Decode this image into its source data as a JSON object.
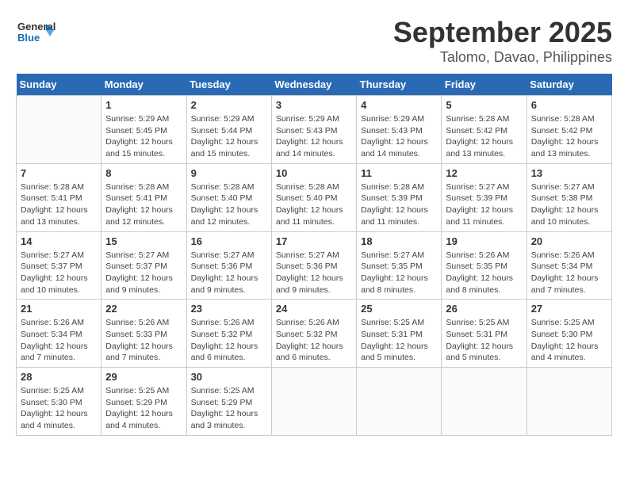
{
  "header": {
    "logo_general": "General",
    "logo_blue": "Blue",
    "month": "September 2025",
    "location": "Talomo, Davao, Philippines"
  },
  "days_of_week": [
    "Sunday",
    "Monday",
    "Tuesday",
    "Wednesday",
    "Thursday",
    "Friday",
    "Saturday"
  ],
  "weeks": [
    [
      {
        "day": "",
        "info": ""
      },
      {
        "day": "1",
        "info": "Sunrise: 5:29 AM\nSunset: 5:45 PM\nDaylight: 12 hours\nand 15 minutes."
      },
      {
        "day": "2",
        "info": "Sunrise: 5:29 AM\nSunset: 5:44 PM\nDaylight: 12 hours\nand 15 minutes."
      },
      {
        "day": "3",
        "info": "Sunrise: 5:29 AM\nSunset: 5:43 PM\nDaylight: 12 hours\nand 14 minutes."
      },
      {
        "day": "4",
        "info": "Sunrise: 5:29 AM\nSunset: 5:43 PM\nDaylight: 12 hours\nand 14 minutes."
      },
      {
        "day": "5",
        "info": "Sunrise: 5:28 AM\nSunset: 5:42 PM\nDaylight: 12 hours\nand 13 minutes."
      },
      {
        "day": "6",
        "info": "Sunrise: 5:28 AM\nSunset: 5:42 PM\nDaylight: 12 hours\nand 13 minutes."
      }
    ],
    [
      {
        "day": "7",
        "info": "Sunrise: 5:28 AM\nSunset: 5:41 PM\nDaylight: 12 hours\nand 13 minutes."
      },
      {
        "day": "8",
        "info": "Sunrise: 5:28 AM\nSunset: 5:41 PM\nDaylight: 12 hours\nand 12 minutes."
      },
      {
        "day": "9",
        "info": "Sunrise: 5:28 AM\nSunset: 5:40 PM\nDaylight: 12 hours\nand 12 minutes."
      },
      {
        "day": "10",
        "info": "Sunrise: 5:28 AM\nSunset: 5:40 PM\nDaylight: 12 hours\nand 11 minutes."
      },
      {
        "day": "11",
        "info": "Sunrise: 5:28 AM\nSunset: 5:39 PM\nDaylight: 12 hours\nand 11 minutes."
      },
      {
        "day": "12",
        "info": "Sunrise: 5:27 AM\nSunset: 5:39 PM\nDaylight: 12 hours\nand 11 minutes."
      },
      {
        "day": "13",
        "info": "Sunrise: 5:27 AM\nSunset: 5:38 PM\nDaylight: 12 hours\nand 10 minutes."
      }
    ],
    [
      {
        "day": "14",
        "info": "Sunrise: 5:27 AM\nSunset: 5:37 PM\nDaylight: 12 hours\nand 10 minutes."
      },
      {
        "day": "15",
        "info": "Sunrise: 5:27 AM\nSunset: 5:37 PM\nDaylight: 12 hours\nand 9 minutes."
      },
      {
        "day": "16",
        "info": "Sunrise: 5:27 AM\nSunset: 5:36 PM\nDaylight: 12 hours\nand 9 minutes."
      },
      {
        "day": "17",
        "info": "Sunrise: 5:27 AM\nSunset: 5:36 PM\nDaylight: 12 hours\nand 9 minutes."
      },
      {
        "day": "18",
        "info": "Sunrise: 5:27 AM\nSunset: 5:35 PM\nDaylight: 12 hours\nand 8 minutes."
      },
      {
        "day": "19",
        "info": "Sunrise: 5:26 AM\nSunset: 5:35 PM\nDaylight: 12 hours\nand 8 minutes."
      },
      {
        "day": "20",
        "info": "Sunrise: 5:26 AM\nSunset: 5:34 PM\nDaylight: 12 hours\nand 7 minutes."
      }
    ],
    [
      {
        "day": "21",
        "info": "Sunrise: 5:26 AM\nSunset: 5:34 PM\nDaylight: 12 hours\nand 7 minutes."
      },
      {
        "day": "22",
        "info": "Sunrise: 5:26 AM\nSunset: 5:33 PM\nDaylight: 12 hours\nand 7 minutes."
      },
      {
        "day": "23",
        "info": "Sunrise: 5:26 AM\nSunset: 5:32 PM\nDaylight: 12 hours\nand 6 minutes."
      },
      {
        "day": "24",
        "info": "Sunrise: 5:26 AM\nSunset: 5:32 PM\nDaylight: 12 hours\nand 6 minutes."
      },
      {
        "day": "25",
        "info": "Sunrise: 5:25 AM\nSunset: 5:31 PM\nDaylight: 12 hours\nand 5 minutes."
      },
      {
        "day": "26",
        "info": "Sunrise: 5:25 AM\nSunset: 5:31 PM\nDaylight: 12 hours\nand 5 minutes."
      },
      {
        "day": "27",
        "info": "Sunrise: 5:25 AM\nSunset: 5:30 PM\nDaylight: 12 hours\nand 4 minutes."
      }
    ],
    [
      {
        "day": "28",
        "info": "Sunrise: 5:25 AM\nSunset: 5:30 PM\nDaylight: 12 hours\nand 4 minutes."
      },
      {
        "day": "29",
        "info": "Sunrise: 5:25 AM\nSunset: 5:29 PM\nDaylight: 12 hours\nand 4 minutes."
      },
      {
        "day": "30",
        "info": "Sunrise: 5:25 AM\nSunset: 5:29 PM\nDaylight: 12 hours\nand 3 minutes."
      },
      {
        "day": "",
        "info": ""
      },
      {
        "day": "",
        "info": ""
      },
      {
        "day": "",
        "info": ""
      },
      {
        "day": "",
        "info": ""
      }
    ]
  ]
}
